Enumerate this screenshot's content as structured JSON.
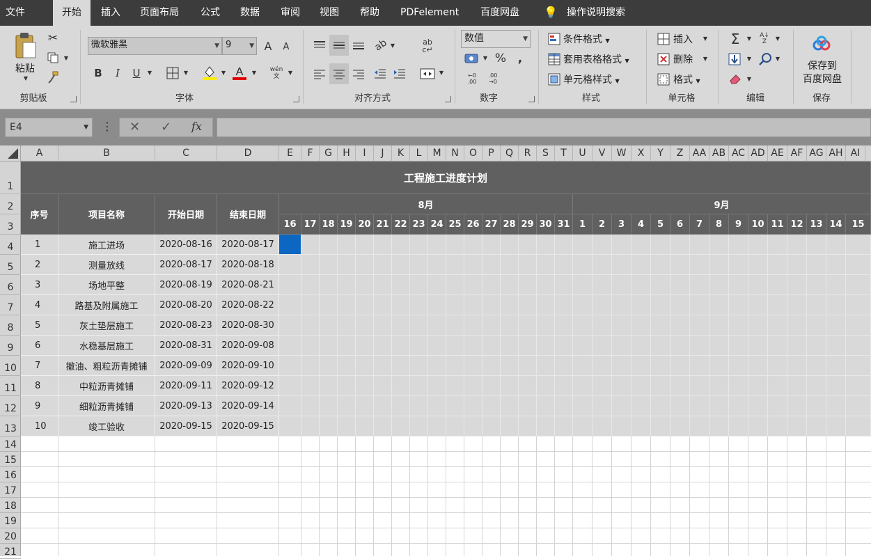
{
  "menu": {
    "tabs": [
      "文件",
      "开始",
      "插入",
      "页面布局",
      "公式",
      "数据",
      "审阅",
      "视图",
      "帮助",
      "PDFelement",
      "百度网盘"
    ],
    "active": "开始",
    "tellme": "操作说明搜索"
  },
  "ribbon": {
    "clipboard": {
      "paste": "粘贴",
      "label": "剪贴板"
    },
    "font": {
      "name": "微软雅黑",
      "size": "9",
      "label": "字体",
      "bold": "B",
      "italic": "I",
      "underline": "U",
      "grow": "A",
      "shrink": "A",
      "wen": "wén"
    },
    "align": {
      "label": "对齐方式"
    },
    "number": {
      "format": "数值",
      "percent": "%",
      "comma": ",",
      "label": "数字"
    },
    "styles": {
      "conditional": "条件格式",
      "table": "套用表格格式",
      "cell": "单元格样式",
      "label": "样式"
    },
    "cells": {
      "insert": "插入",
      "delete": "删除",
      "format": "格式",
      "label": "单元格"
    },
    "editing": {
      "sum": "Σ",
      "label": "编辑"
    },
    "save": {
      "line1": "保存到",
      "line2": "百度网盘",
      "label": "保存"
    }
  },
  "formula": {
    "namebox": "E4",
    "cancel": "✕",
    "enter": "✓",
    "fx": "fx",
    "content": ""
  },
  "columns": [
    "A",
    "B",
    "C",
    "D",
    "E",
    "F",
    "G",
    "H",
    "I",
    "J",
    "K",
    "L",
    "M",
    "N",
    "O",
    "P",
    "Q",
    "R",
    "S",
    "T",
    "U",
    "V",
    "W",
    "X",
    "Y",
    "Z",
    "AA",
    "AB",
    "AC",
    "AD",
    "AE",
    "AF",
    "AG",
    "AH",
    "AI"
  ],
  "rows": [
    "1",
    "2",
    "3",
    "4",
    "5",
    "6",
    "7",
    "8",
    "9",
    "10",
    "11",
    "12",
    "13",
    "14",
    "15",
    "16",
    "17",
    "18",
    "19",
    "20",
    "21"
  ],
  "sheet": {
    "title": "工程施工进度计划",
    "headers": {
      "seq": "序号",
      "name": "项目名称",
      "start": "开始日期",
      "end": "结束日期"
    },
    "months": [
      "8月",
      "9月"
    ],
    "days": [
      "16",
      "17",
      "18",
      "19",
      "20",
      "21",
      "22",
      "23",
      "24",
      "25",
      "26",
      "27",
      "28",
      "29",
      "30",
      "31",
      "1",
      "2",
      "3",
      "4",
      "5",
      "6",
      "7",
      "8",
      "9",
      "10",
      "11",
      "12",
      "13",
      "14",
      "15"
    ],
    "tasks": [
      {
        "seq": "1",
        "name": "施工进场",
        "start": "2020-08-16",
        "end": "2020-08-17"
      },
      {
        "seq": "2",
        "name": "测量放线",
        "start": "2020-08-17",
        "end": "2020-08-18"
      },
      {
        "seq": "3",
        "name": "场地平整",
        "start": "2020-08-19",
        "end": "2020-08-21"
      },
      {
        "seq": "4",
        "name": "路基及附属施工",
        "start": "2020-08-20",
        "end": "2020-08-22"
      },
      {
        "seq": "5",
        "name": "灰土垫层施工",
        "start": "2020-08-23",
        "end": "2020-08-30"
      },
      {
        "seq": "6",
        "name": "水稳基层施工",
        "start": "2020-08-31",
        "end": "2020-09-08"
      },
      {
        "seq": "7",
        "name": "撤油、粗粒沥青摊铺",
        "start": "2020-09-09",
        "end": "2020-09-10"
      },
      {
        "seq": "8",
        "name": "中粒沥青摊铺",
        "start": "2020-09-11",
        "end": "2020-09-12"
      },
      {
        "seq": "9",
        "name": "细粒沥青摊铺",
        "start": "2020-09-13",
        "end": "2020-09-14"
      },
      {
        "seq": "10",
        "name": "竣工验收",
        "start": "2020-09-15",
        "end": "2020-09-15"
      }
    ]
  },
  "colors": {
    "selection": "#0b67c2",
    "headerFill": "#606060",
    "dataFill": "#d9d9d9",
    "fontRed": "#e00000",
    "highlightYellow": "#ffee00"
  }
}
